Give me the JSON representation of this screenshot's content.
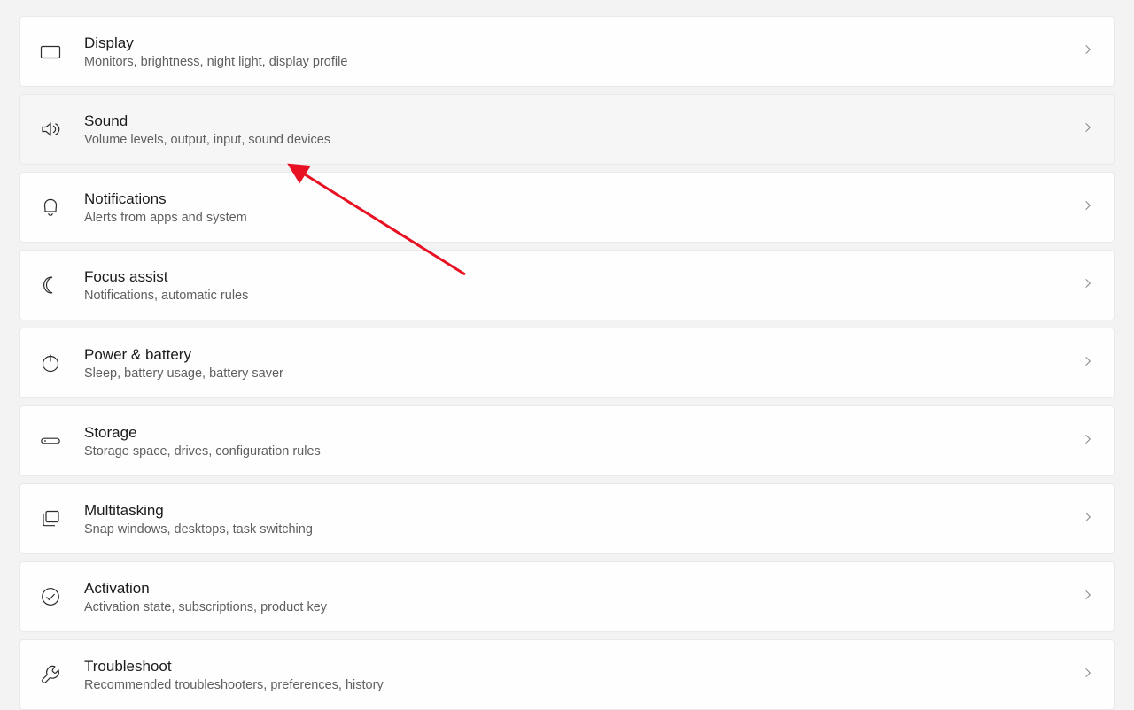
{
  "settings": [
    {
      "id": "display",
      "title": "Display",
      "desc": "Monitors, brightness, night light, display profile",
      "icon": "display-icon"
    },
    {
      "id": "sound",
      "title": "Sound",
      "desc": "Volume levels, output, input, sound devices",
      "icon": "sound-icon",
      "highlight": true
    },
    {
      "id": "notifications",
      "title": "Notifications",
      "desc": "Alerts from apps and system",
      "icon": "bell-icon"
    },
    {
      "id": "focus-assist",
      "title": "Focus assist",
      "desc": "Notifications, automatic rules",
      "icon": "moon-icon"
    },
    {
      "id": "power-battery",
      "title": "Power & battery",
      "desc": "Sleep, battery usage, battery saver",
      "icon": "power-icon"
    },
    {
      "id": "storage",
      "title": "Storage",
      "desc": "Storage space, drives, configuration rules",
      "icon": "drive-icon"
    },
    {
      "id": "multitasking",
      "title": "Multitasking",
      "desc": "Snap windows, desktops, task switching",
      "icon": "multitask-icon"
    },
    {
      "id": "activation",
      "title": "Activation",
      "desc": "Activation state, subscriptions, product key",
      "icon": "check-circle-icon"
    },
    {
      "id": "troubleshoot",
      "title": "Troubleshoot",
      "desc": "Recommended troubleshooters, preferences, history",
      "icon": "wrench-icon"
    }
  ],
  "annotation": {
    "arrow_color": "#e81123"
  }
}
